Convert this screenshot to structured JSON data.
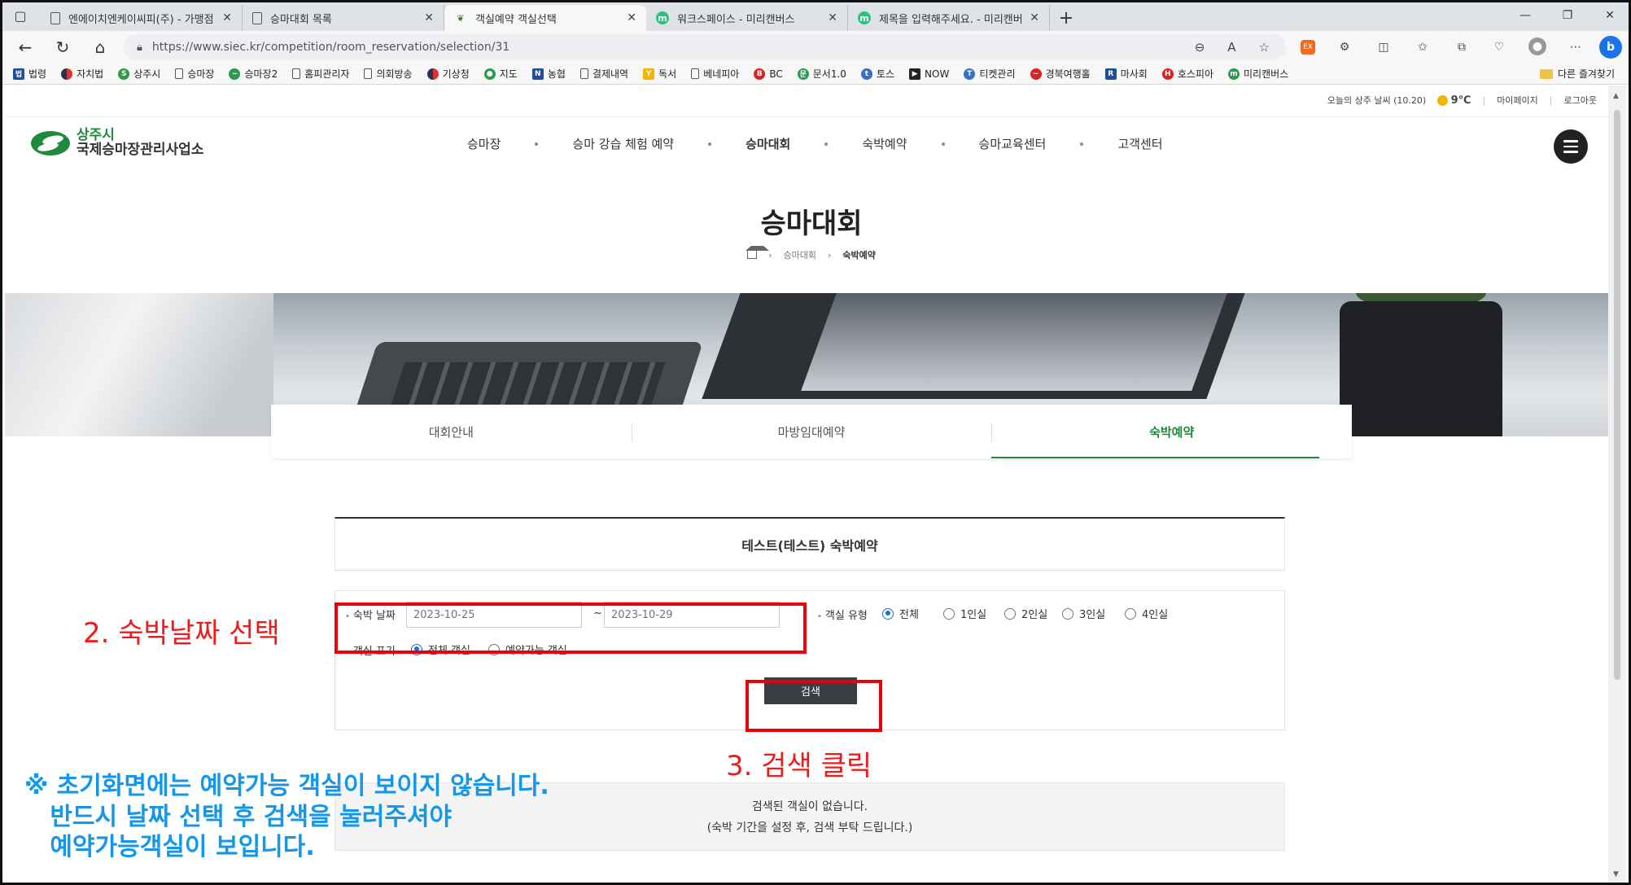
{
  "browser": {
    "tabs": [
      {
        "title": "엔에이치엔케이씨피(주) - 가맹점",
        "icon": "doc"
      },
      {
        "title": "승마대회 목록",
        "icon": "doc"
      },
      {
        "title": "객실예약 객실선택",
        "icon": "leaf",
        "active": true
      },
      {
        "title": "워크스페이스 - 미리캔버스",
        "icon": "m"
      },
      {
        "title": "제목을 입력해주세요. - 미리캔버스",
        "icon": "m"
      }
    ],
    "url": "https://www.siec.kr/competition/room_reservation/selection/31",
    "bookmarks": [
      {
        "label": "법령",
        "icon": "blue",
        "glyph": "법"
      },
      {
        "label": "자치법",
        "icon": "kr",
        "glyph": ""
      },
      {
        "label": "상주시",
        "icon": "grn",
        "glyph": "S"
      },
      {
        "label": "승마장",
        "icon": "doc",
        "glyph": ""
      },
      {
        "label": "승마장2",
        "icon": "grn",
        "glyph": "~"
      },
      {
        "label": "홈피관리자",
        "icon": "doc",
        "glyph": ""
      },
      {
        "label": "의회방송",
        "icon": "doc",
        "glyph": ""
      },
      {
        "label": "기상청",
        "icon": "kr",
        "glyph": ""
      },
      {
        "label": "지도",
        "icon": "grn",
        "glyph": "●"
      },
      {
        "label": "농협",
        "icon": "blue",
        "glyph": "N"
      },
      {
        "label": "결제내역",
        "icon": "doc",
        "glyph": ""
      },
      {
        "label": "독서",
        "icon": "yel",
        "glyph": "Y"
      },
      {
        "label": "베네피아",
        "icon": "doc",
        "glyph": ""
      },
      {
        "label": "BC",
        "icon": "red",
        "glyph": "B"
      },
      {
        "label": "문서1.0",
        "icon": "grn",
        "glyph": "문"
      },
      {
        "label": "토스",
        "icon": "tk",
        "glyph": "t"
      },
      {
        "label": "NOW",
        "icon": "dark",
        "glyph": "▶"
      },
      {
        "label": "티켓관리",
        "icon": "tk",
        "glyph": "T"
      },
      {
        "label": "경북여행홀",
        "icon": "red",
        "glyph": "~"
      },
      {
        "label": "마사회",
        "icon": "blue",
        "glyph": "R"
      },
      {
        "label": "호스피아",
        "icon": "red",
        "glyph": "H"
      },
      {
        "label": "미리캔버스",
        "icon": "grn",
        "glyph": "m"
      }
    ],
    "bookmarks_other": "다른 즐겨찾기"
  },
  "util": {
    "weather_label": "오늘의 상주 날씨 (10.20)",
    "temp": "9℃",
    "mypage": "마이페이지",
    "logout": "로그아웃"
  },
  "logo": {
    "line1": "상주시",
    "line2": "국제승마장관리사업소"
  },
  "menu": [
    "승마장",
    "승마 강습 체험 예약",
    "승마대회",
    "숙박예약",
    "승마교육센터",
    "고객센터"
  ],
  "menu_active": 2,
  "page_title": "승마대회",
  "breadcrumb": [
    "승마대회",
    "숙박예약"
  ],
  "subtabs": [
    "대회안내",
    "마방임대예약",
    "숙박예약"
  ],
  "subtab_active": 2,
  "panel_title": "테스트(테스트) 숙박예약",
  "form": {
    "date_label": "숙박 날짜",
    "date_from_placeholder": "2023-10-25",
    "date_to_placeholder": "2023-10-29",
    "tilde": "~",
    "room_type_label": "객실 유형",
    "room_types": [
      "전체",
      "1인실",
      "2인실",
      "3인실",
      "4인실"
    ],
    "room_type_selected": 0,
    "display_label": "객실 표기",
    "display_options": [
      "전체 객실",
      "예약가능 객실"
    ],
    "display_selected": 0,
    "search_button": "검색"
  },
  "result": {
    "line1": "검색된 객실이 없습니다.",
    "line2": "(숙박 기간을 설정 후, 검색 부탁 드립니다.)"
  },
  "annotations": {
    "step2": "2. 숙박날짜 선택",
    "step3": "3. 검색 클릭",
    "note": "※ 초기화면에는 예약가능 객실이 보이지 않습니다.\n   반드시 날짜 선택 후 검색을 눌러주셔야\n   예약가능객실이 보입니다.",
    "red": "#e8000c",
    "blue": "#1497e8"
  },
  "colors": {
    "brand_green": "#1d8b3b",
    "search_button": "#3a3d42"
  }
}
